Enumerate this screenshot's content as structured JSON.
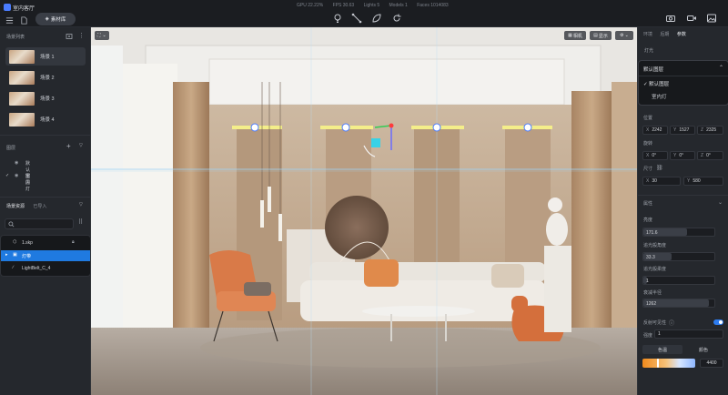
{
  "app": {
    "title": "室内客厅"
  },
  "toolbar": {
    "mode_label": "素材库",
    "stats": [
      "GPU 22.22%",
      "FPS 30.63",
      "Lights 5",
      "Models 1",
      "Faces 1014083"
    ]
  },
  "left": {
    "scene_list_title": "场景列表",
    "scenes": [
      "场景 1",
      "场景 2",
      "场景 3",
      "场景 4"
    ],
    "layers_title": "图层",
    "layers": [
      "默认图层",
      "室内灯"
    ],
    "asset_tabs": [
      "场景资源",
      "已导入"
    ],
    "search": {
      "placeholder": "",
      "value": ""
    },
    "tree": [
      "1.skp",
      "灯带",
      "LightBelt_C_4"
    ]
  },
  "viewport": {
    "view_btn": "⌄",
    "camera_btn": "相机",
    "display_btn": "显示",
    "more_btn": "⌄"
  },
  "right": {
    "tabs": [
      "环境",
      "后期",
      "参数"
    ],
    "lighting_label": "灯光",
    "dropdown": {
      "selected": "默认图层",
      "options": [
        "默认图层",
        "室内灯"
      ]
    },
    "position": {
      "label": "位置",
      "x": "2242",
      "y": "1527",
      "z": "2325"
    },
    "rotation": {
      "label": "旋转",
      "x": "0°",
      "y": "0°",
      "z": "0°"
    },
    "size": {
      "label": "尺寸",
      "x": "30",
      "y": "580"
    },
    "props_title": "属性",
    "brightness": {
      "label": "亮度",
      "value": "171.6",
      "level": 0.62
    },
    "spread": {
      "label": "追光般角度",
      "value": "33.3",
      "level": 0.4
    },
    "softness": {
      "label": "追光般柔度",
      "value": "1",
      "level": 0.05
    },
    "radius": {
      "label": "衰减半径",
      "value": "1262",
      "level": 0.92
    },
    "reflect": {
      "label": "反射可见性",
      "on": true
    },
    "intensity": {
      "label": "强度",
      "value": "1"
    },
    "color_tabs": [
      "色温",
      "颜色"
    ],
    "temperature": "4400"
  }
}
